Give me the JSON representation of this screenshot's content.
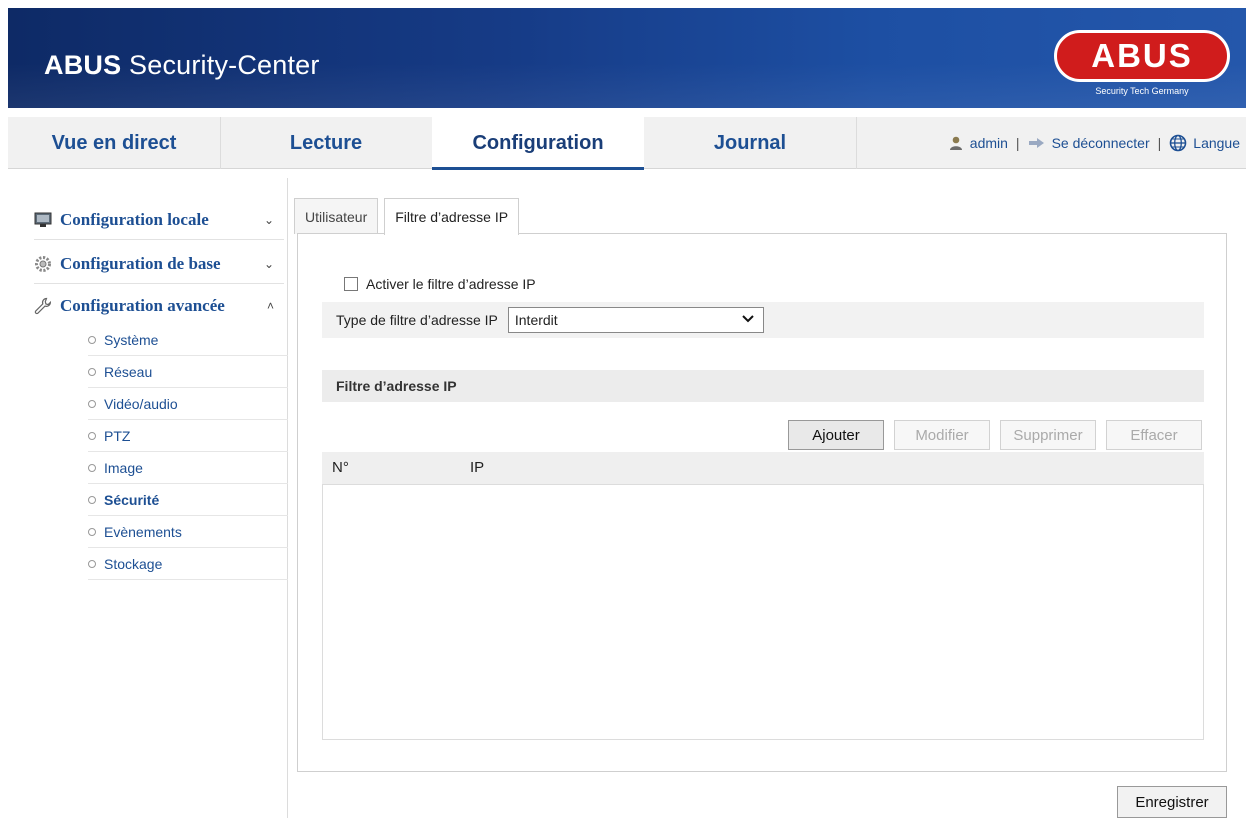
{
  "header": {
    "brand_bold": "ABUS",
    "brand_rest": " Security-Center",
    "logo_text": "ABUS",
    "logo_tagline": "Security Tech Germany",
    "brand_color": "#163b86",
    "logo_color": "#d01c1c"
  },
  "nav": {
    "tabs": [
      {
        "label": "Vue en direct"
      },
      {
        "label": "Lecture"
      },
      {
        "label": "Configuration"
      },
      {
        "label": "Journal"
      }
    ],
    "active_tab": "Configuration",
    "user": "admin",
    "logout": "Se déconnecter",
    "language": "Langue",
    "separator": "|"
  },
  "sidebar": {
    "sections": [
      {
        "label": "Configuration locale",
        "chevron": "⌄",
        "icon": "monitor-icon"
      },
      {
        "label": "Configuration de base",
        "chevron": "⌄",
        "icon": "gear-icon"
      },
      {
        "label": "Configuration avancée",
        "chevron": "˄",
        "icon": "wrench-icon"
      }
    ],
    "items": [
      {
        "label": "Système"
      },
      {
        "label": "Réseau"
      },
      {
        "label": "Vidéo/audio"
      },
      {
        "label": "PTZ"
      },
      {
        "label": "Image"
      },
      {
        "label": "Sécurité"
      },
      {
        "label": "Evènements"
      },
      {
        "label": "Stockage"
      }
    ],
    "active_item": "Sécurité"
  },
  "content": {
    "tabs": [
      {
        "label": "Utilisateur"
      },
      {
        "label": "Filtre d’adresse IP"
      }
    ],
    "active_tab": "Filtre d’adresse IP",
    "enable_label": "Activer le filtre d’adresse IP",
    "enable_checked": false,
    "type_label": "Type de filtre d’adresse IP",
    "type_value": "Interdit",
    "section_title": "Filtre d’adresse IP",
    "buttons": {
      "add": "Ajouter",
      "modify": "Modifier",
      "delete": "Supprimer",
      "clear": "Effacer"
    },
    "table": {
      "columns": [
        "N°",
        "IP"
      ],
      "rows": []
    },
    "save": "Enregistrer"
  }
}
